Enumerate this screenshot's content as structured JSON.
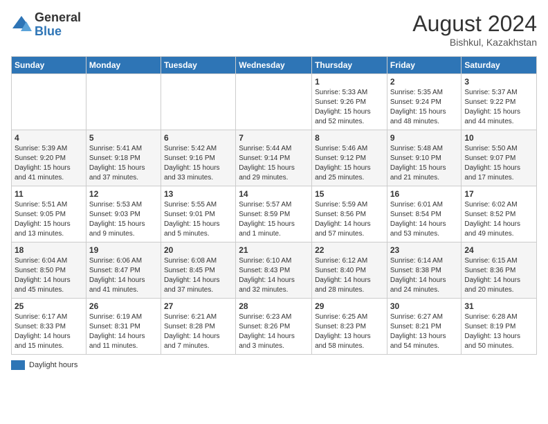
{
  "header": {
    "logo_general": "General",
    "logo_blue": "Blue",
    "month_year": "August 2024",
    "location": "Bishkul, Kazakhstan"
  },
  "legend": {
    "label": "Daylight hours"
  },
  "weekdays": [
    "Sunday",
    "Monday",
    "Tuesday",
    "Wednesday",
    "Thursday",
    "Friday",
    "Saturday"
  ],
  "weeks": [
    [
      {
        "day": "",
        "info": ""
      },
      {
        "day": "",
        "info": ""
      },
      {
        "day": "",
        "info": ""
      },
      {
        "day": "",
        "info": ""
      },
      {
        "day": "1",
        "info": "Sunrise: 5:33 AM\nSunset: 9:26 PM\nDaylight: 15 hours\nand 52 minutes."
      },
      {
        "day": "2",
        "info": "Sunrise: 5:35 AM\nSunset: 9:24 PM\nDaylight: 15 hours\nand 48 minutes."
      },
      {
        "day": "3",
        "info": "Sunrise: 5:37 AM\nSunset: 9:22 PM\nDaylight: 15 hours\nand 44 minutes."
      }
    ],
    [
      {
        "day": "4",
        "info": "Sunrise: 5:39 AM\nSunset: 9:20 PM\nDaylight: 15 hours\nand 41 minutes."
      },
      {
        "day": "5",
        "info": "Sunrise: 5:41 AM\nSunset: 9:18 PM\nDaylight: 15 hours\nand 37 minutes."
      },
      {
        "day": "6",
        "info": "Sunrise: 5:42 AM\nSunset: 9:16 PM\nDaylight: 15 hours\nand 33 minutes."
      },
      {
        "day": "7",
        "info": "Sunrise: 5:44 AM\nSunset: 9:14 PM\nDaylight: 15 hours\nand 29 minutes."
      },
      {
        "day": "8",
        "info": "Sunrise: 5:46 AM\nSunset: 9:12 PM\nDaylight: 15 hours\nand 25 minutes."
      },
      {
        "day": "9",
        "info": "Sunrise: 5:48 AM\nSunset: 9:10 PM\nDaylight: 15 hours\nand 21 minutes."
      },
      {
        "day": "10",
        "info": "Sunrise: 5:50 AM\nSunset: 9:07 PM\nDaylight: 15 hours\nand 17 minutes."
      }
    ],
    [
      {
        "day": "11",
        "info": "Sunrise: 5:51 AM\nSunset: 9:05 PM\nDaylight: 15 hours\nand 13 minutes."
      },
      {
        "day": "12",
        "info": "Sunrise: 5:53 AM\nSunset: 9:03 PM\nDaylight: 15 hours\nand 9 minutes."
      },
      {
        "day": "13",
        "info": "Sunrise: 5:55 AM\nSunset: 9:01 PM\nDaylight: 15 hours\nand 5 minutes."
      },
      {
        "day": "14",
        "info": "Sunrise: 5:57 AM\nSunset: 8:59 PM\nDaylight: 15 hours\nand 1 minute."
      },
      {
        "day": "15",
        "info": "Sunrise: 5:59 AM\nSunset: 8:56 PM\nDaylight: 14 hours\nand 57 minutes."
      },
      {
        "day": "16",
        "info": "Sunrise: 6:01 AM\nSunset: 8:54 PM\nDaylight: 14 hours\nand 53 minutes."
      },
      {
        "day": "17",
        "info": "Sunrise: 6:02 AM\nSunset: 8:52 PM\nDaylight: 14 hours\nand 49 minutes."
      }
    ],
    [
      {
        "day": "18",
        "info": "Sunrise: 6:04 AM\nSunset: 8:50 PM\nDaylight: 14 hours\nand 45 minutes."
      },
      {
        "day": "19",
        "info": "Sunrise: 6:06 AM\nSunset: 8:47 PM\nDaylight: 14 hours\nand 41 minutes."
      },
      {
        "day": "20",
        "info": "Sunrise: 6:08 AM\nSunset: 8:45 PM\nDaylight: 14 hours\nand 37 minutes."
      },
      {
        "day": "21",
        "info": "Sunrise: 6:10 AM\nSunset: 8:43 PM\nDaylight: 14 hours\nand 32 minutes."
      },
      {
        "day": "22",
        "info": "Sunrise: 6:12 AM\nSunset: 8:40 PM\nDaylight: 14 hours\nand 28 minutes."
      },
      {
        "day": "23",
        "info": "Sunrise: 6:14 AM\nSunset: 8:38 PM\nDaylight: 14 hours\nand 24 minutes."
      },
      {
        "day": "24",
        "info": "Sunrise: 6:15 AM\nSunset: 8:36 PM\nDaylight: 14 hours\nand 20 minutes."
      }
    ],
    [
      {
        "day": "25",
        "info": "Sunrise: 6:17 AM\nSunset: 8:33 PM\nDaylight: 14 hours\nand 15 minutes."
      },
      {
        "day": "26",
        "info": "Sunrise: 6:19 AM\nSunset: 8:31 PM\nDaylight: 14 hours\nand 11 minutes."
      },
      {
        "day": "27",
        "info": "Sunrise: 6:21 AM\nSunset: 8:28 PM\nDaylight: 14 hours\nand 7 minutes."
      },
      {
        "day": "28",
        "info": "Sunrise: 6:23 AM\nSunset: 8:26 PM\nDaylight: 14 hours\nand 3 minutes."
      },
      {
        "day": "29",
        "info": "Sunrise: 6:25 AM\nSunset: 8:23 PM\nDaylight: 13 hours\nand 58 minutes."
      },
      {
        "day": "30",
        "info": "Sunrise: 6:27 AM\nSunset: 8:21 PM\nDaylight: 13 hours\nand 54 minutes."
      },
      {
        "day": "31",
        "info": "Sunrise: 6:28 AM\nSunset: 8:19 PM\nDaylight: 13 hours\nand 50 minutes."
      }
    ]
  ]
}
